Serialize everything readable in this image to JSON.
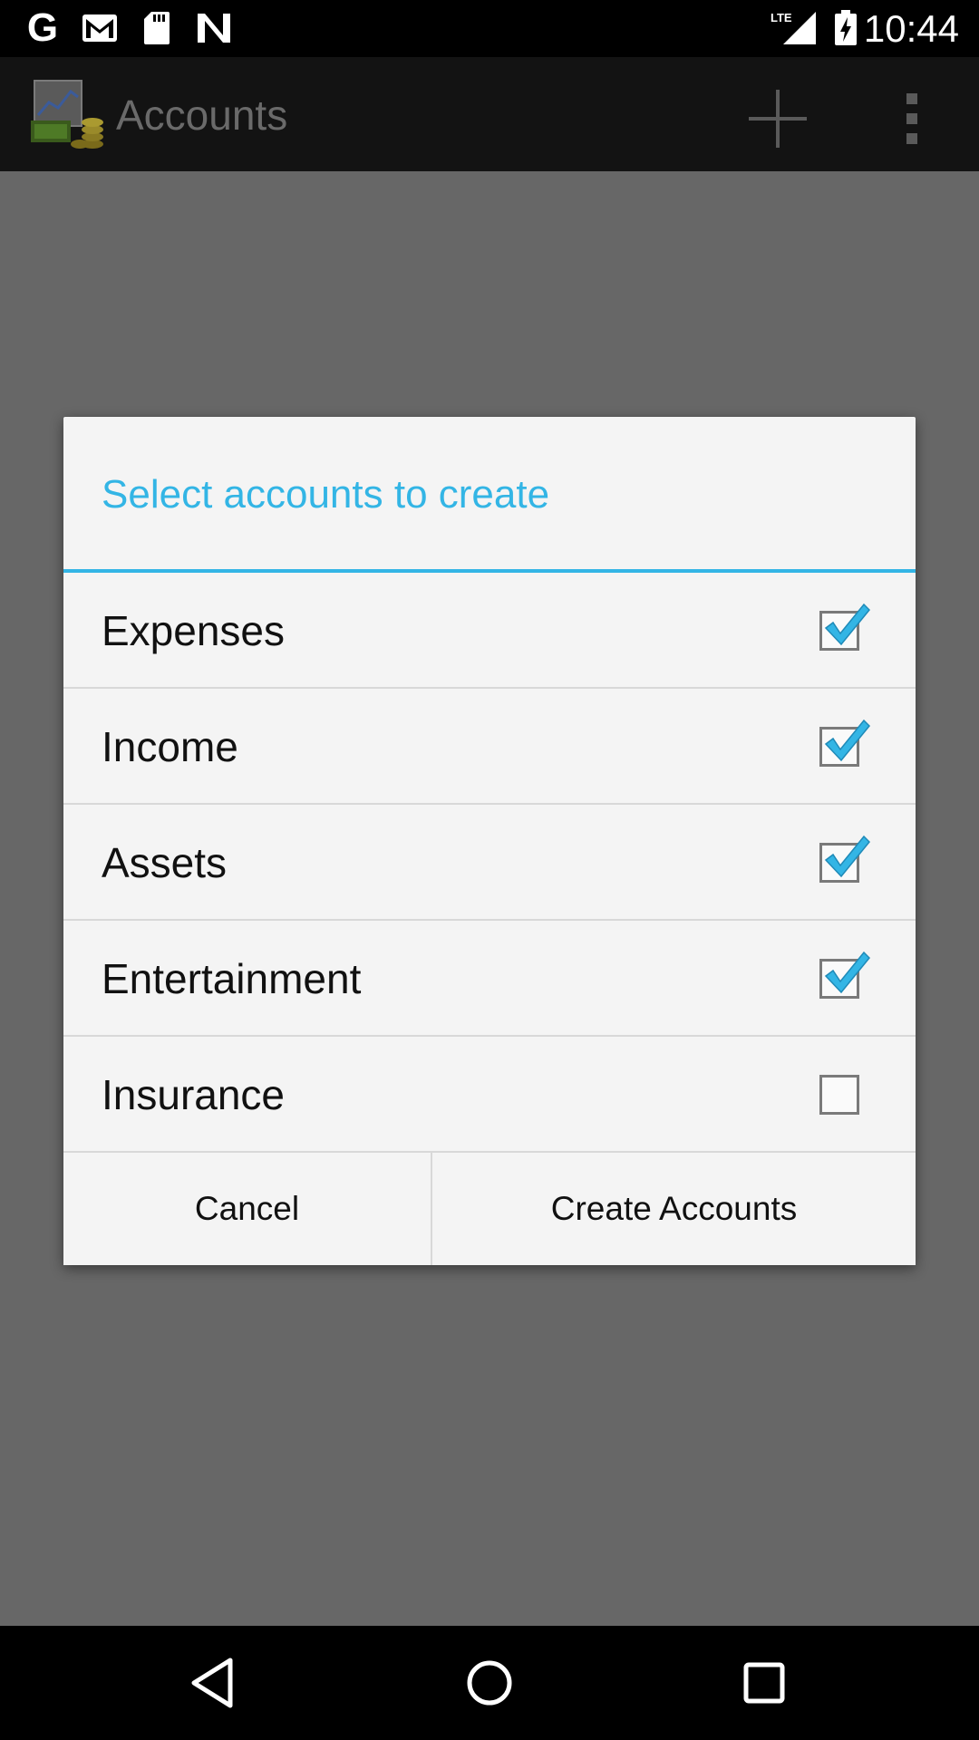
{
  "status_bar": {
    "g_label": "G",
    "lte_label": "LTE",
    "time": "10:44",
    "icons": [
      "google-icon",
      "gmail-icon",
      "sd-card-icon",
      "n-icon",
      "lte-signal-icon",
      "battery-charging-icon"
    ]
  },
  "action_bar": {
    "title": "Accounts",
    "icons": [
      "app-logo-icon",
      "add-icon",
      "overflow-menu-icon"
    ]
  },
  "dialog": {
    "title": "Select accounts to create",
    "options": [
      {
        "label": "Expenses",
        "checked": true
      },
      {
        "label": "Income",
        "checked": true
      },
      {
        "label": "Assets",
        "checked": true
      },
      {
        "label": "Entertainment",
        "checked": true
      },
      {
        "label": "Insurance",
        "checked": false
      }
    ],
    "cancel_label": "Cancel",
    "create_label": "Create Accounts"
  },
  "nav_bar": {
    "icons": [
      "back-icon",
      "home-icon",
      "recents-icon"
    ]
  },
  "colors": {
    "accent": "#33b5e5",
    "dialog_bg": "#f4f4f4",
    "scrim": "#676767"
  }
}
